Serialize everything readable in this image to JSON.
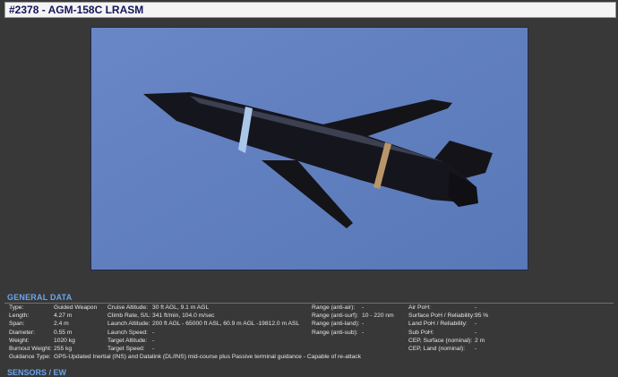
{
  "header": {
    "title": "#2378 - AGM-158C LRASM"
  },
  "image": {
    "subject": "missile-photo",
    "colors": {
      "sky": "#5f80c0",
      "body": "#15151d"
    }
  },
  "general_data": {
    "section_title": "GENERAL DATA",
    "col1": [
      {
        "label": "Type:",
        "value": "Guided Weapon"
      },
      {
        "label": "Length:",
        "value": "4.27 m"
      },
      {
        "label": "Span:",
        "value": "2.4 m"
      },
      {
        "label": "Diameter:",
        "value": "0.55 m"
      },
      {
        "label": "Weight:",
        "value": "1020 kg"
      },
      {
        "label": "Burnout Weight:",
        "value": "255 kg"
      }
    ],
    "col2": [
      {
        "label": "Cruise Altitude:",
        "value": "30 ft AGL, 9.1 m AGL"
      },
      {
        "label": "Climb Rate, S/L:",
        "value": "341 ft/min, 104.0 m/sec"
      },
      {
        "label": "Launch Altitude:",
        "value": "200 ft AGL - 65000 ft ASL, 60.9 m AGL -19812.0 m ASL"
      },
      {
        "label": "Launch Speed:",
        "value": "-"
      },
      {
        "label": "Target Altitude:",
        "value": "-"
      },
      {
        "label": "Target Speed:",
        "value": "-"
      }
    ],
    "col3": [
      {
        "label": "Range (anti-air):",
        "value": "-"
      },
      {
        "label": "Range (anti-surf):",
        "value": "10 - 220 nm"
      },
      {
        "label": "Range (anti-land):",
        "value": "-"
      },
      {
        "label": "Range (anti-sub):",
        "value": "-"
      }
    ],
    "col4": [
      {
        "label": "Air PoH:",
        "value": "-"
      },
      {
        "label": "Surface PoH / Reliability:",
        "value": "95 %"
      },
      {
        "label": "Land PoH / Reliability:",
        "value": "-"
      },
      {
        "label": "Sub PoH:",
        "value": "-"
      },
      {
        "label": "CEP, Surface (nominal):",
        "value": "2 m"
      },
      {
        "label": "CEP, Land (nominal):",
        "value": "-"
      }
    ],
    "guidance": {
      "label": "Guidance Type:",
      "value": "GPS-Updated Inertial (INS) and Datalink (DL/INS) mid-course plus Passive terminal guidance - Capable of re-attack"
    }
  },
  "sensors": {
    "section_title": "SENSORS / EW"
  }
}
